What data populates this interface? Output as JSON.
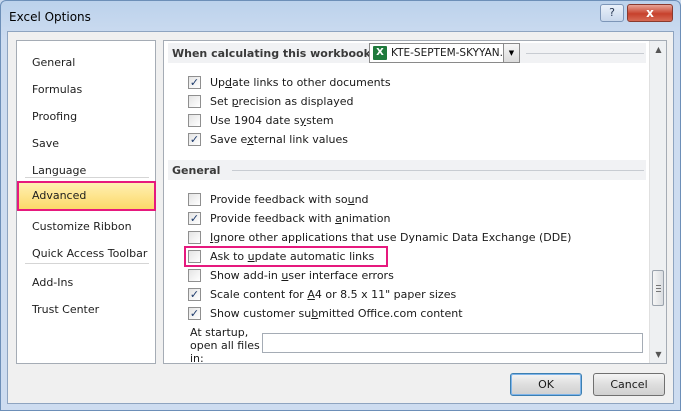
{
  "window": {
    "title": "Excel Options",
    "help_glyph": "?",
    "close_glyph": "x"
  },
  "sidebar": {
    "items": [
      {
        "label": "General"
      },
      {
        "label": "Formulas"
      },
      {
        "label": "Proofing"
      },
      {
        "label": "Save"
      },
      {
        "label": "Language"
      },
      {
        "label": "Advanced",
        "selected": true
      },
      {
        "label": "Customize Ribbon"
      },
      {
        "label": "Quick Access Toolbar"
      },
      {
        "label": "Add-Ins"
      },
      {
        "label": "Trust Center"
      }
    ]
  },
  "calc_section": {
    "header": "When calculating this workbook:",
    "workbook_value": "KTE-SEPTEM-SKYYAN...",
    "options": [
      {
        "label": "Update links to other documents",
        "checked": true
      },
      {
        "label": "Set precision as displayed",
        "checked": false
      },
      {
        "label": "Use 1904 date system",
        "checked": false
      },
      {
        "label": "Save external link values",
        "checked": true
      }
    ]
  },
  "general_section": {
    "header": "General",
    "options": [
      {
        "label": "Provide feedback with sound",
        "checked": false
      },
      {
        "label": "Provide feedback with animation",
        "checked": true
      },
      {
        "label": "Ignore other applications that use Dynamic Data Exchange (DDE)",
        "checked": false
      },
      {
        "label": "Ask to update automatic links",
        "checked": false
      },
      {
        "label": "Show add-in user interface errors",
        "checked": false
      },
      {
        "label": "Scale content for A4 or 8.5 x 11\" paper sizes",
        "checked": true
      },
      {
        "label": "Show customer submitted Office.com content",
        "checked": true
      }
    ],
    "startup_label": "At startup, open all files in:",
    "startup_value": ""
  },
  "buttons": {
    "ok": "OK",
    "cancel": "Cancel"
  },
  "colors": {
    "selected_nav_bg": "#fcd866",
    "annotation_box": "#e6197e"
  }
}
